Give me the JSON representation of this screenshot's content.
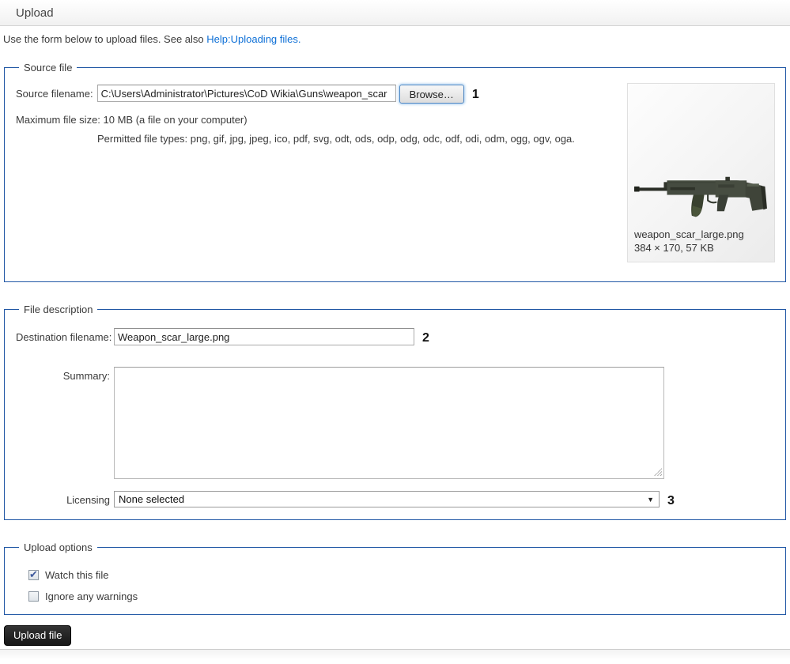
{
  "page": {
    "title": "Upload"
  },
  "intro": {
    "text": "Use the form below to upload files. See also ",
    "link_text": "Help:Uploading files."
  },
  "source_file": {
    "legend": "Source file",
    "filename_label": "Source filename:",
    "filename_value": "C:\\Users\\Administrator\\Pictures\\CoD Wikia\\Guns\\weapon_scar",
    "browse_label": "Browse…",
    "annotation": "1",
    "max_size_text": "Maximum file size: 10 MB (a file on your computer)",
    "permitted_text": "Permitted file types: png, gif, jpg, jpeg, ico, pdf, svg, odt, ods, odp, odg, odc, odf, odi, odm, ogg, ogv, oga.",
    "preview": {
      "filename": "weapon_scar_large.png",
      "meta": "384 × 170, 57 KB"
    }
  },
  "file_description": {
    "legend": "File description",
    "destination_label": "Destination filename:",
    "destination_value": "Weapon_scar_large.png",
    "destination_annotation": "2",
    "summary_label": "Summary:",
    "summary_value": "",
    "licensing_label": "Licensing",
    "licensing_value": "None selected",
    "licensing_arrow": "▼",
    "licensing_annotation": "3"
  },
  "upload_options": {
    "legend": "Upload options",
    "watch": {
      "label": "Watch this file",
      "checked": true
    },
    "ignore": {
      "label": "Ignore any warnings",
      "checked": false
    }
  },
  "actions": {
    "upload_label": "Upload file"
  },
  "interface_colors": {
    "fieldset_border": "#2157a5",
    "link": "#0d6fd6",
    "upload_button_bg": "#1a1a1a",
    "checkmark": "#3f5a9d"
  }
}
